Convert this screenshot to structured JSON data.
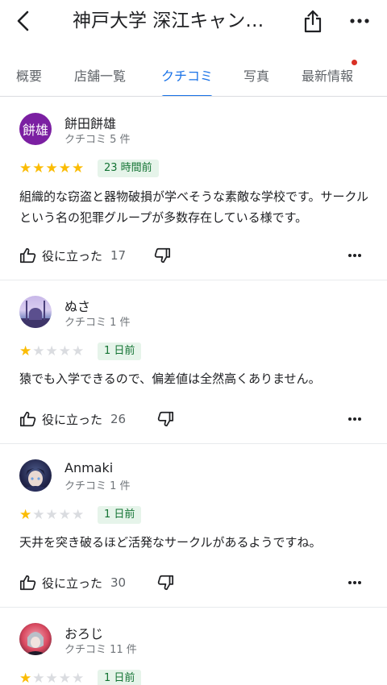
{
  "header": {
    "title": "神戸大学 深江キャン…"
  },
  "tabs": [
    {
      "label": "概要",
      "active": false
    },
    {
      "label": "店舗一覧",
      "active": false
    },
    {
      "label": "クチコミ",
      "active": true
    },
    {
      "label": "写真",
      "active": false
    },
    {
      "label": "最新情報",
      "active": false,
      "has_badge": true
    }
  ],
  "reviews": [
    {
      "name": "餅田餅雄",
      "avatar_text": "餅雄",
      "review_count": "クチコミ 5 件",
      "rating": 5,
      "time": "23 時間前",
      "text": "組織的な窃盗と器物破損が学べそうな素敵な学校です。サークルという名の犯罪グループが多数存在している様です。",
      "helpful_label": "役に立った",
      "helpful_count": "17"
    },
    {
      "name": "ぬさ",
      "review_count": "クチコミ 1 件",
      "rating": 1,
      "time": "1 日前",
      "text": "猿でも入学できるので、偏差値は全然高くありません。",
      "helpful_label": "役に立った",
      "helpful_count": "26"
    },
    {
      "name": "Anmaki",
      "review_count": "クチコミ 1 件",
      "rating": 1,
      "time": "1 日前",
      "text": "天井を突き破るほど活発なサークルがあるようですね。",
      "helpful_label": "役に立った",
      "helpful_count": "30"
    },
    {
      "name": "おろじ",
      "review_count": "クチコミ 11 件",
      "rating": 1,
      "time": "1 日前"
    }
  ],
  "colors": {
    "accent": "#1a73e8",
    "star": "#fbbc04",
    "badge_bg": "#e6f4ea",
    "badge_text": "#137333",
    "notification_dot": "#d93025",
    "avatar_1": "#7b1fa2"
  }
}
